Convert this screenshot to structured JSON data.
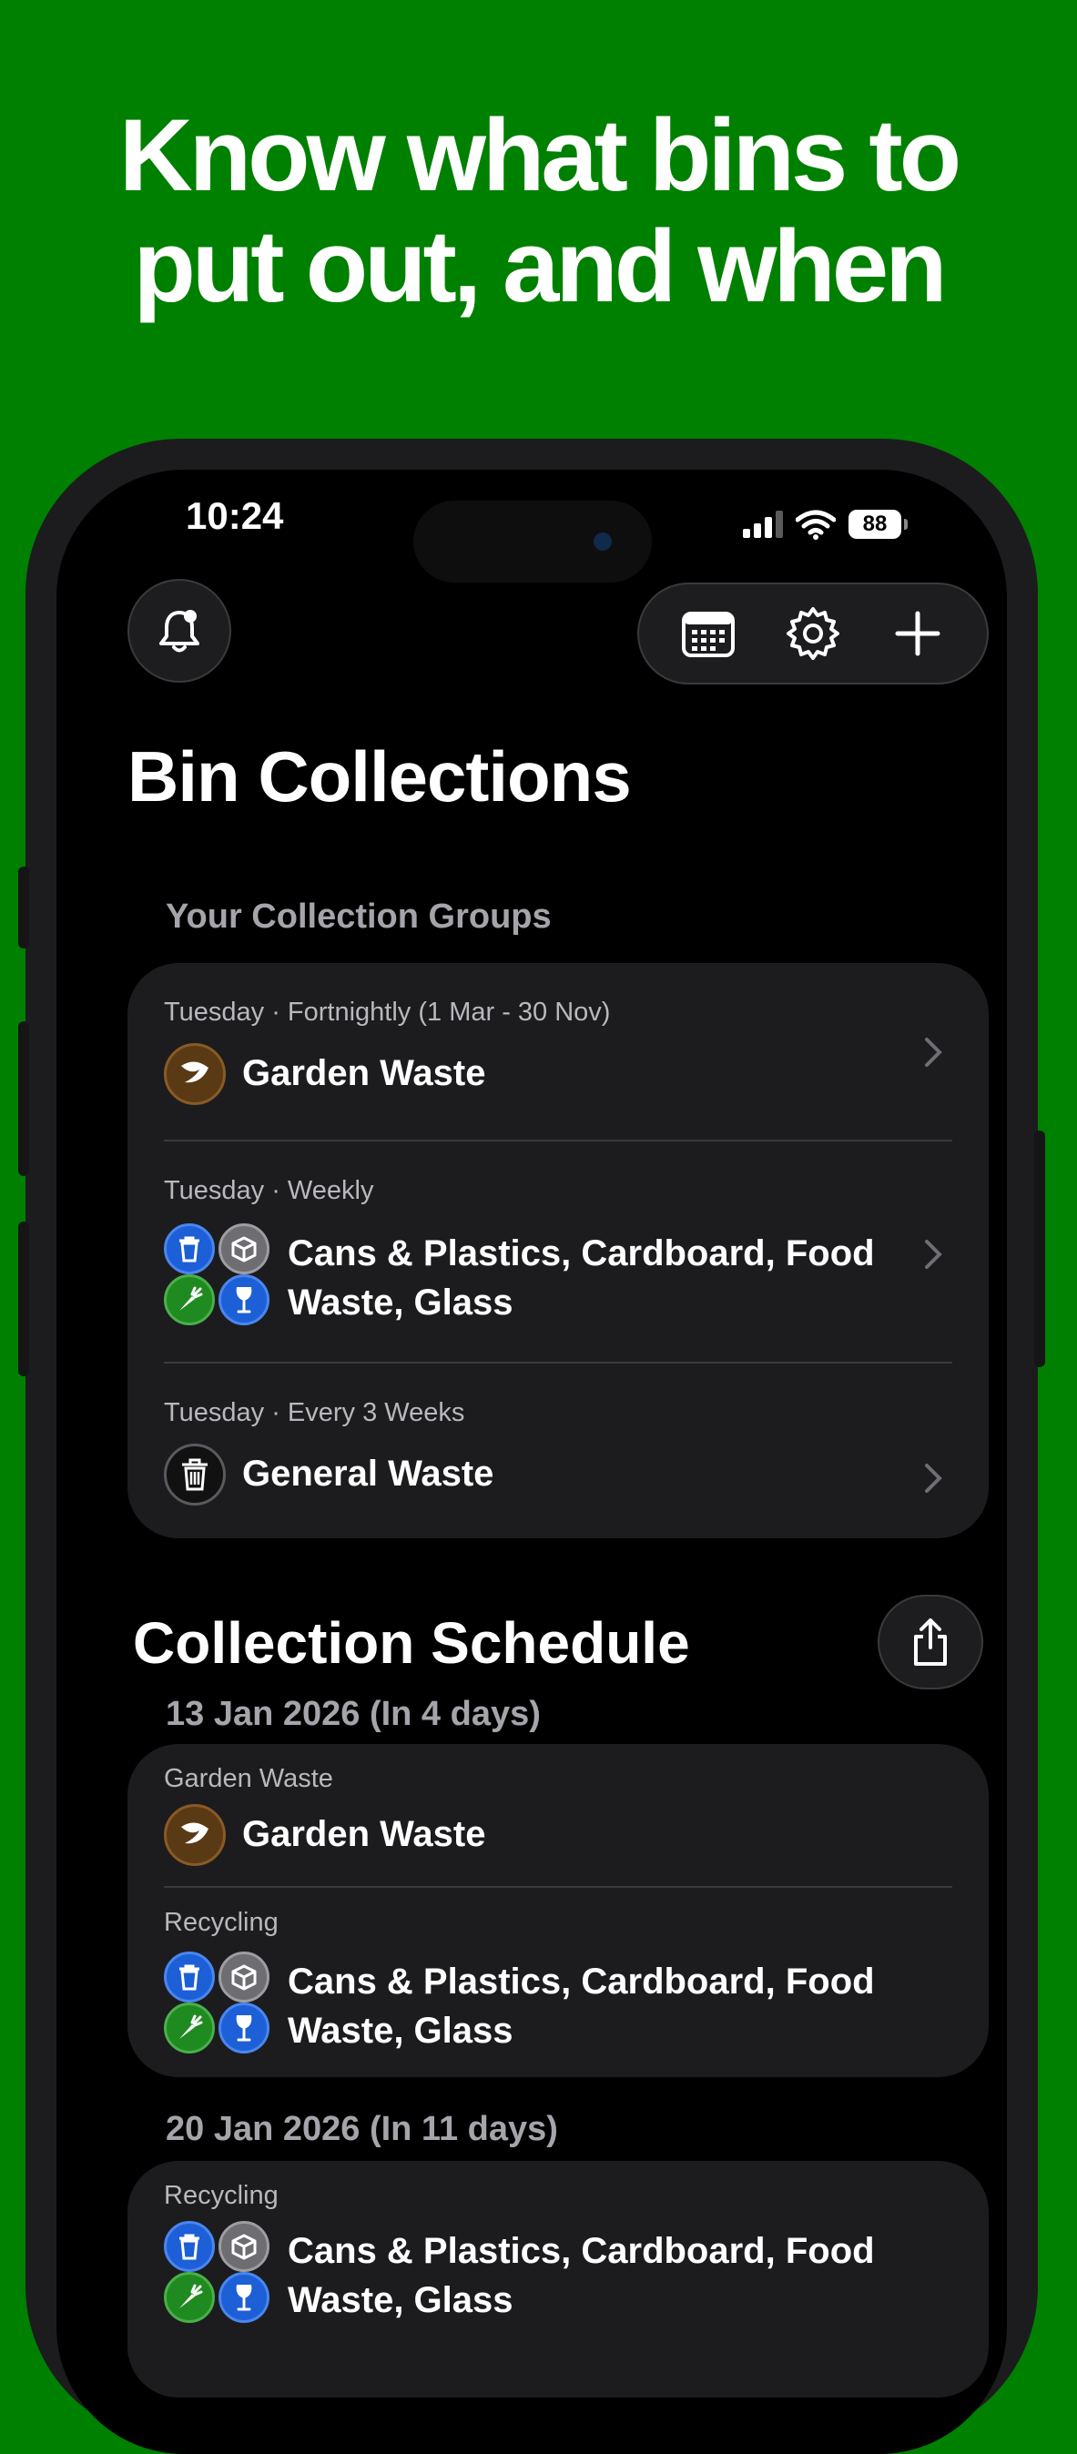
{
  "headline": {
    "line1": "Know what bins to",
    "line2": "put out, and when"
  },
  "status_bar": {
    "time": "10:24",
    "battery": "88"
  },
  "toolbar": {
    "bell": "bell-icon",
    "calendar": "calendar-icon",
    "settings": "gear-icon",
    "add": "plus-icon"
  },
  "title": "Bin Collections",
  "groups": {
    "header": "Your Collection Groups",
    "items": [
      {
        "meta": "Tuesday · Fortnightly (1 Mar - 30 Nov)",
        "line1": "Garden Waste",
        "line2": "",
        "icons": [
          "leaf-icon"
        ]
      },
      {
        "meta": "Tuesday · Weekly",
        "line1": "Cans & Plastics, Cardboard, Food",
        "line2": "Waste, Glass",
        "icons": [
          "bin-icon",
          "box-icon",
          "carrot-icon",
          "wine-glass-icon"
        ]
      },
      {
        "meta": "Tuesday · Every 3 Weeks",
        "line1": "General Waste",
        "line2": "",
        "icons": [
          "trash-icon"
        ]
      }
    ]
  },
  "schedule": {
    "title": "Collection Schedule",
    "share": "share-icon",
    "dates": [
      {
        "date": "13 Jan 2026 (In 4 days)",
        "entries": [
          {
            "group": "Garden Waste",
            "line1": "Garden Waste",
            "line2": ""
          },
          {
            "group": "Recycling",
            "line1": "Cans & Plastics, Cardboard, Food",
            "line2": "Waste, Glass"
          }
        ]
      },
      {
        "date": "20 Jan 2026 (In 11 days)",
        "entries": [
          {
            "group": "Recycling",
            "line1": "Cans & Plastics, Cardboard, Food",
            "line2": "Waste, Glass"
          }
        ]
      }
    ]
  },
  "colors": {
    "background": "#008000",
    "garden": "#5a3a14",
    "recycling_blue": "#1d5fd6",
    "cardboard_grey": "#6d6d72",
    "food_green": "#1f8a1f"
  }
}
